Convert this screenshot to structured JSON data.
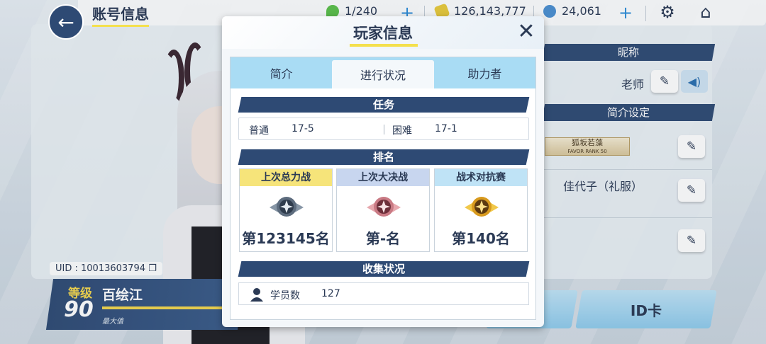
{
  "header": {
    "page_title": "账号信息",
    "ap": "1/240",
    "credits": "126,143,777",
    "pyroxene": "24,061"
  },
  "background_panel": {
    "nickname_header": "昵称",
    "nickname": "老师",
    "intro_header": "简介设定",
    "favor_badge": "狐坂若藻",
    "favor_rank": "FAVOR RANK 50",
    "assistant_name": "佳代子（礼服）"
  },
  "player": {
    "uid": "UID : 10013603794",
    "level_label": "等级",
    "level": "90",
    "name": "百绘江",
    "level_max": "最大值"
  },
  "id_card_button": "ID卡",
  "modal": {
    "title": "玩家信息",
    "close": "✕",
    "tabs": [
      "简介",
      "进行状况",
      "助力者"
    ],
    "active_tab": "进行状况",
    "mission": {
      "header": "任务",
      "normal_label": "普通",
      "normal_value": "17-5",
      "hard_label": "困难",
      "hard_value": "17-1"
    },
    "ranking": {
      "header": "排名",
      "cards": [
        {
          "title": "上次总力战",
          "value": "第123145名",
          "color": "#f6e47a",
          "medal": "silver"
        },
        {
          "title": "上次大决战",
          "value": "第-名",
          "color": "#c8d6ef",
          "medal": "pink"
        },
        {
          "title": "战术对抗赛",
          "value": "第140名",
          "color": "#bfe3f6",
          "medal": "gold"
        }
      ]
    },
    "collection": {
      "header": "收集状况",
      "students_label": "学员数",
      "students_value": "127"
    }
  },
  "colors": {
    "navy": "#2e4a74",
    "accent_yellow": "#f4e04d",
    "tab_bar": "#a9dcf4",
    "plus_blue": "#2a8bd8"
  },
  "icons": [
    "back-arrow-icon",
    "stamina-icon",
    "credit-icon",
    "pyroxene-icon",
    "gear-icon",
    "home-icon",
    "pencil-icon",
    "speaker-icon",
    "copy-icon",
    "close-icon",
    "person-icon",
    "medal-icon"
  ]
}
